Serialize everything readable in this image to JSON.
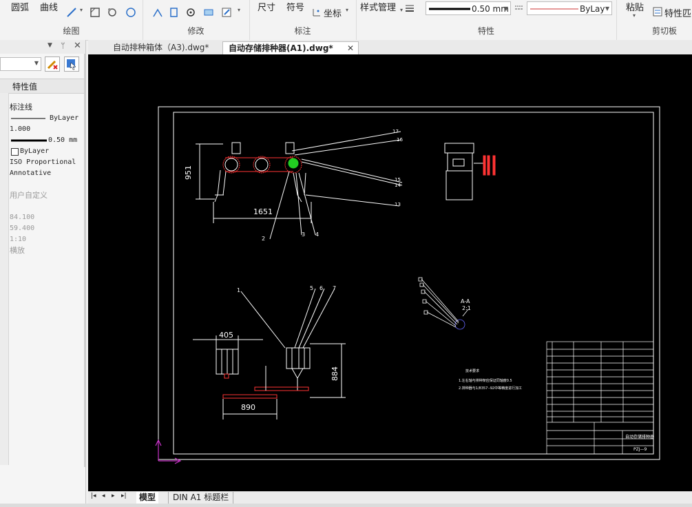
{
  "ribbon": {
    "draw": {
      "arc": "圆弧",
      "curve": "曲线",
      "title": "绘图"
    },
    "modify": {
      "title": "修改"
    },
    "annotate": {
      "dimension": "尺寸",
      "symbol": "符号",
      "coord": "坐标",
      "title": "标注"
    },
    "properties": {
      "style_manager": "样式管理",
      "lineweight_value": "0.50 mm",
      "linetype_value": "ByLay",
      "title": "特性"
    },
    "clipboard": {
      "paste": "粘贴",
      "match_props": "特性匹",
      "title": "剪切板"
    }
  },
  "panel": {
    "header_label": "特性值",
    "props": [
      "标注线",
      "ByLayer",
      "1.000",
      "0.50 mm",
      "ByLayer",
      "ISO Proportional",
      "Annotative"
    ],
    "custom_header": "用户自定义",
    "grey_values": [
      "84.100",
      "59.400",
      "1:10",
      "横放"
    ]
  },
  "tabs": [
    {
      "label": "自动排种箱体（A3).dwg*"
    },
    {
      "label": "自动存储排种器(A1).dwg*",
      "active": true
    }
  ],
  "drawing": {
    "dims": {
      "d951": "951",
      "d1651": "1651",
      "d405": "405",
      "d884": "884",
      "d890": "890"
    },
    "callouts": [
      "1",
      "2",
      "3",
      "4",
      "5",
      "6",
      "7",
      "13",
      "14",
      "15",
      "16",
      "17"
    ],
    "section_label": "A-A",
    "section_scale": "2:1",
    "notes_title": "技术要求",
    "note1": "1.左右轴与排种架应保证同轴度0.5",
    "note2": "2.排种器与1/8357·-92中等精度进行加工",
    "titleblock_name": "自动存储排种器",
    "titleblock_code": "PZJ—9"
  },
  "layout_tabs": {
    "model": "模型",
    "layout1": "DIN A1 标题栏"
  },
  "colors": {
    "canvas": "#000000",
    "geometry": "#ffffff",
    "highlight": "#ff3333",
    "accent_green": "#22cc22",
    "ucs": "#cc33cc"
  }
}
